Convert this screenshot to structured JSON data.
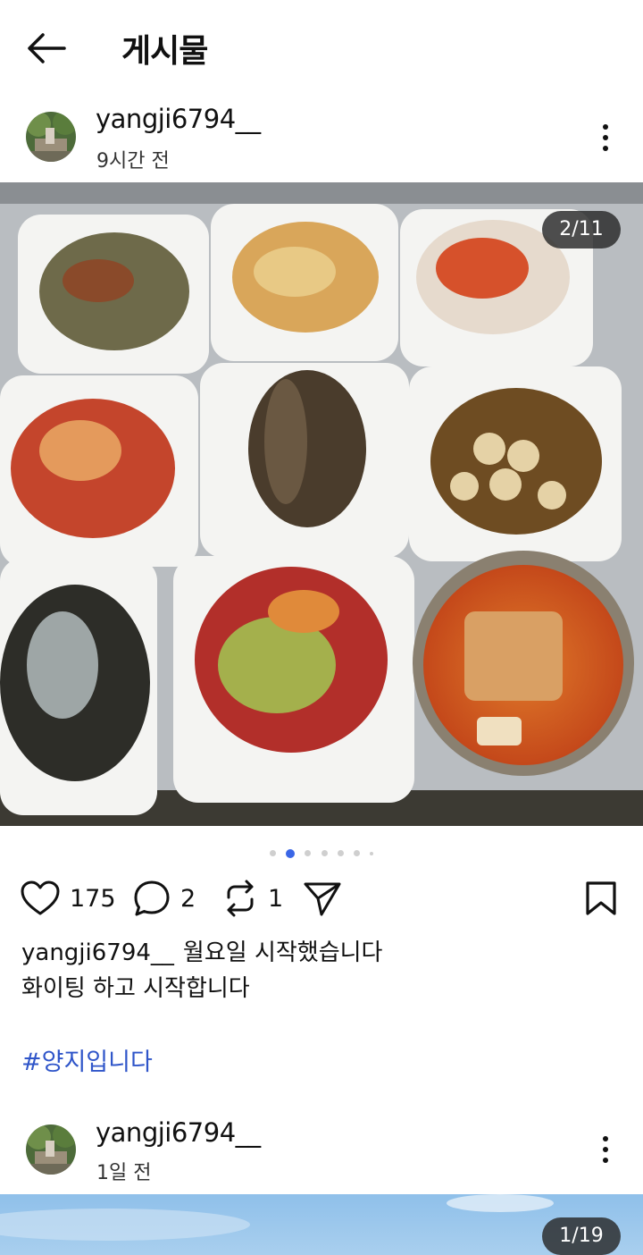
{
  "header": {
    "title": "게시물"
  },
  "posts": [
    {
      "username": "yangji6794__",
      "time": "9시간 전",
      "counter": "2/11",
      "likes": "175",
      "comments": "2",
      "reposts": "1",
      "caption_text": "월요일 시작했습니다",
      "caption_line2": "화이팅 하고 시작합니다",
      "hashtag": "#양지입니다"
    },
    {
      "username": "yangji6794__",
      "time": "1일 전",
      "counter": "1/19"
    }
  ],
  "carousel": {
    "total_dots": 7,
    "active_index": 1
  },
  "colors": {
    "accent": "#3a66e6",
    "hashtag": "#2f55c9"
  },
  "icons": [
    "back-arrow-icon",
    "more-vert-icon",
    "heart-icon",
    "comment-icon",
    "repost-icon",
    "share-icon",
    "bookmark-icon"
  ]
}
